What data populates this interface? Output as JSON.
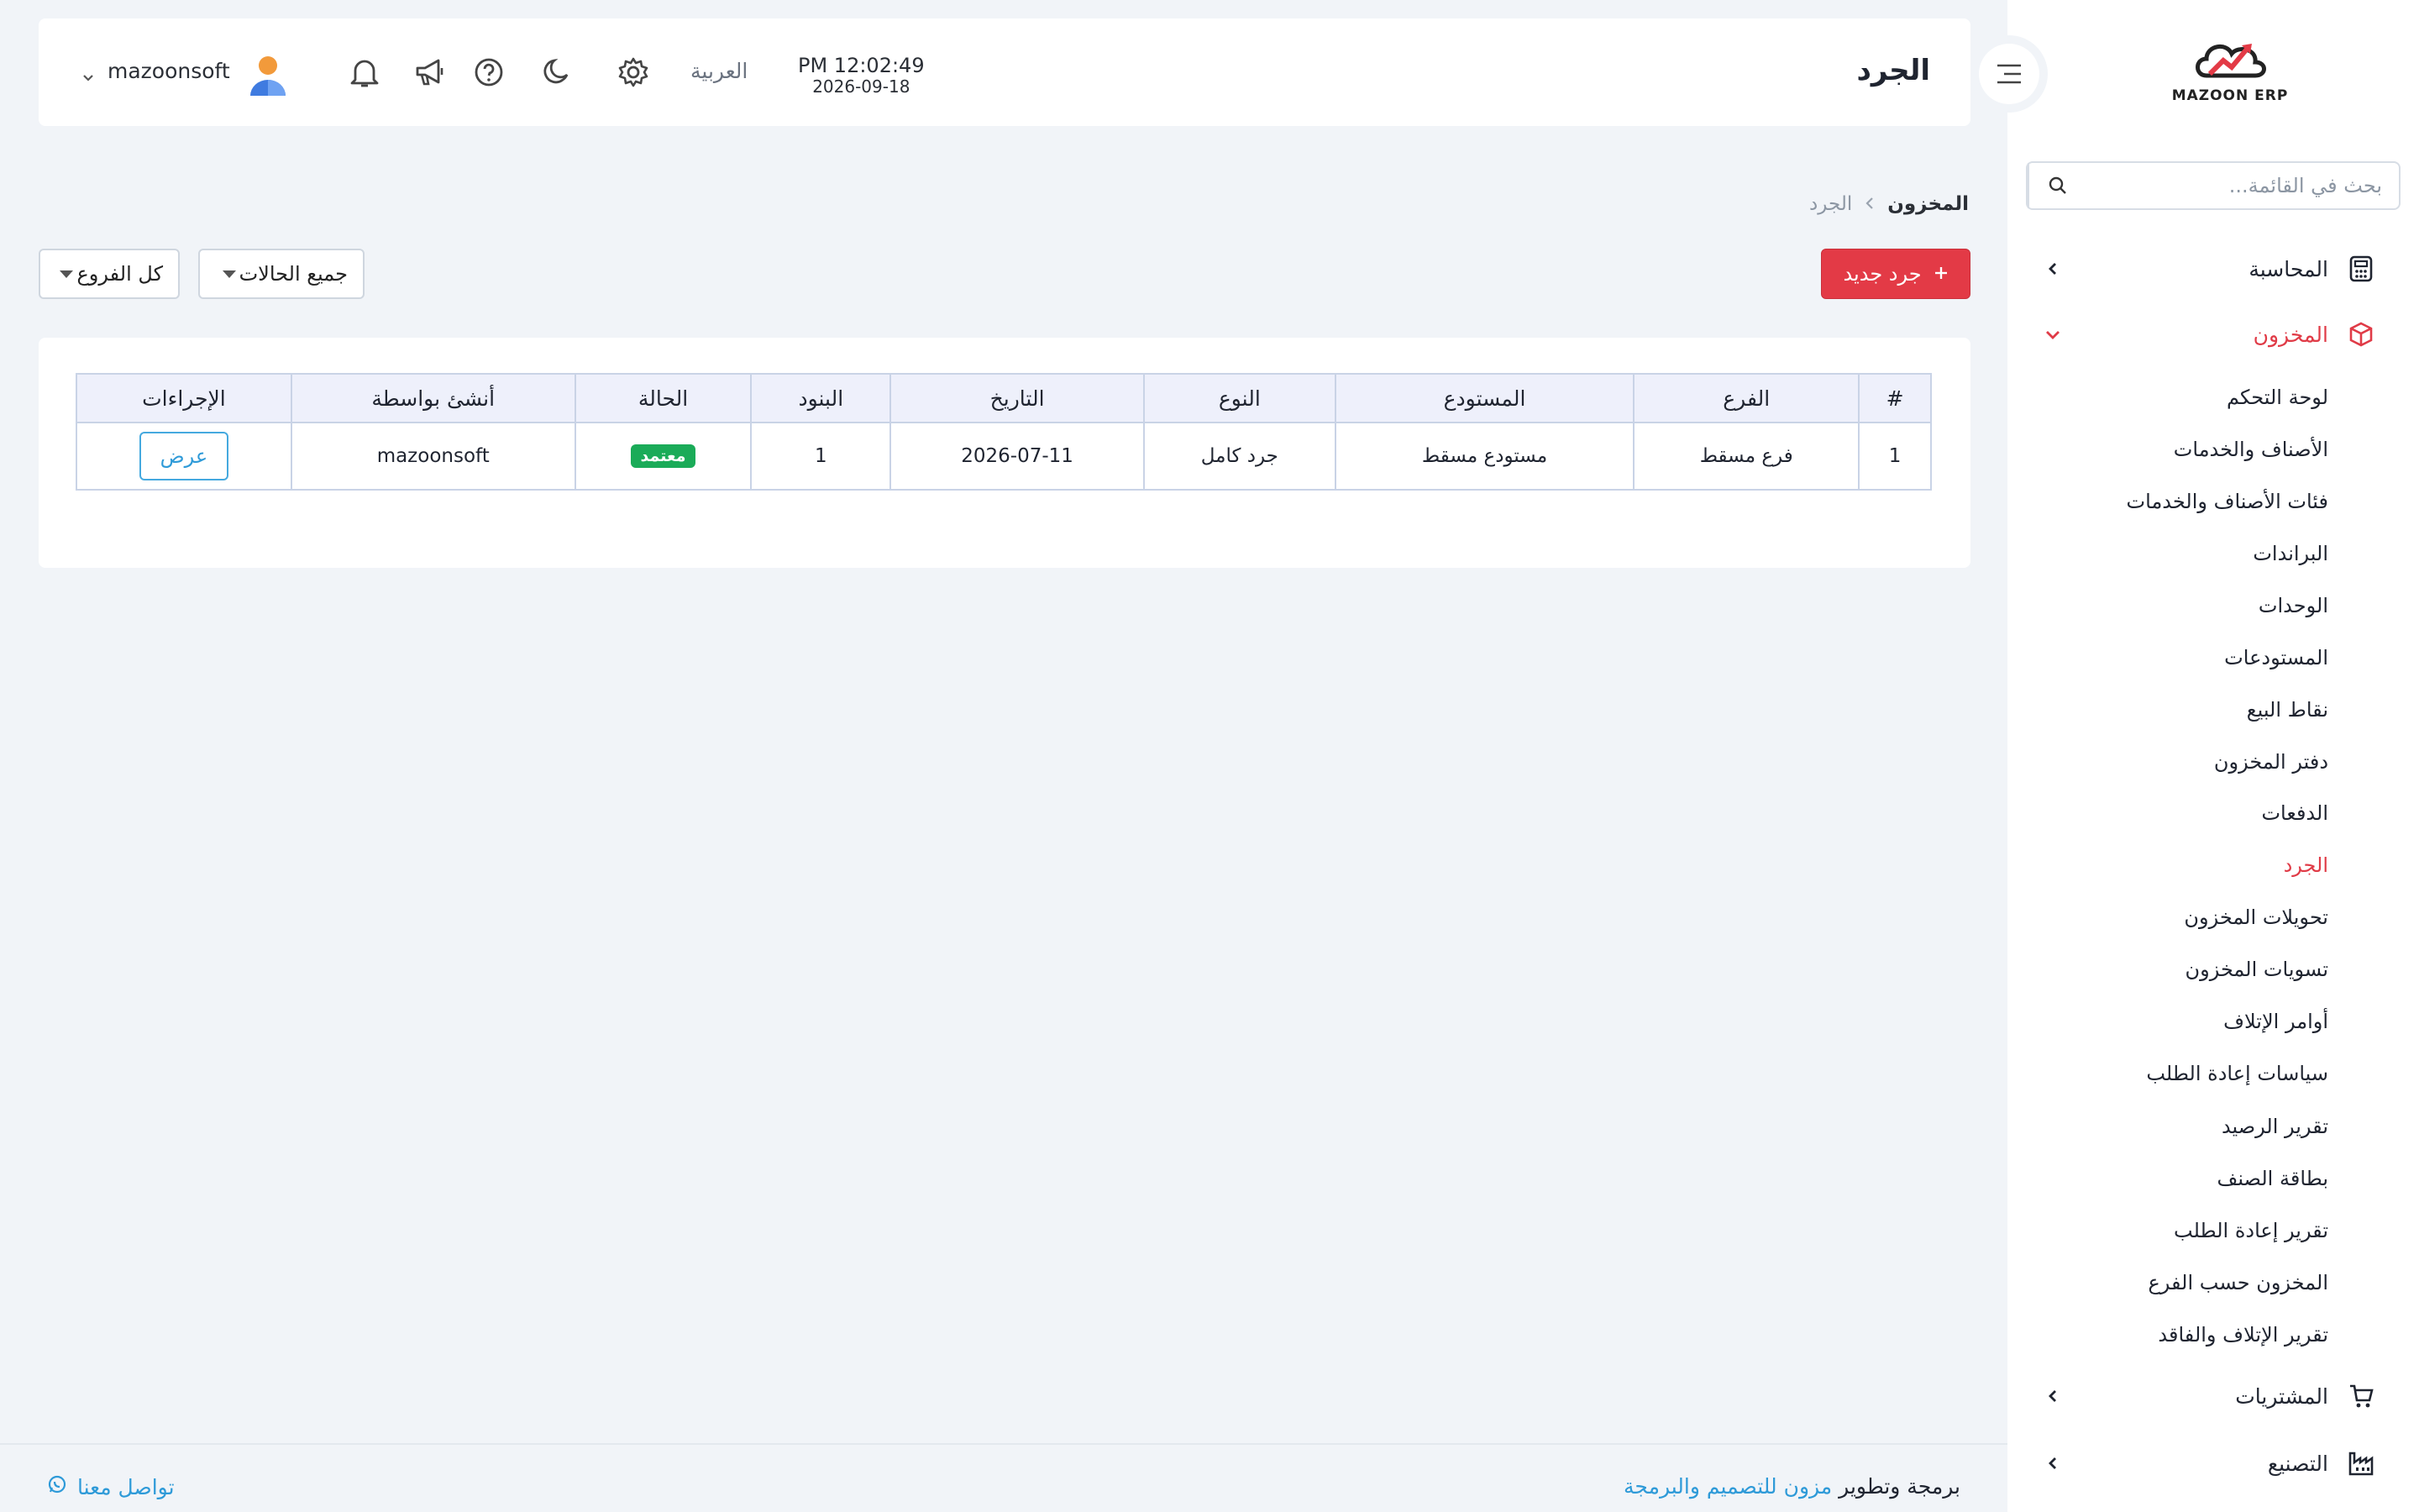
{
  "sidebar": {
    "logo_text": "MAZOON ERP",
    "search_placeholder": "بحث في القائمة...",
    "groups": [
      {
        "label": "المحاسبة",
        "icon": "calculator-icon"
      },
      {
        "label": "المخزون",
        "icon": "box-icon"
      },
      {
        "label": "المشتريات",
        "icon": "cart-icon"
      },
      {
        "label": "التصنيع",
        "icon": "factory-icon"
      }
    ],
    "inventory_items": [
      "لوحة التحكم",
      "الأصناف والخدمات",
      "فئات الأصناف والخدمات",
      "البراندات",
      "الوحدات",
      "المستودعات",
      "نقاط البيع",
      "دفتر المخزون",
      "الدفعات",
      "الجرد",
      "تحويلات المخزون",
      "تسويات المخزون",
      "أوامر الإتلاف",
      "سياسات إعادة الطلب",
      "تقرير الرصيد",
      "بطاقة الصنف",
      "تقرير إعادة الطلب",
      "المخزون حسب الفرع",
      "تقرير الإتلاف والفاقد"
    ]
  },
  "header": {
    "title": "الجرد",
    "time": "PM 12:02:49",
    "date": "2026-09-18",
    "language": "العربية",
    "user": "mazoonsoft"
  },
  "breadcrumb": {
    "parent": "المخزون",
    "current": "الجرد"
  },
  "toolbar": {
    "new_label": "جرد جديد",
    "status_filter": "جميع الحالات",
    "branch_filter": "كل الفروع"
  },
  "table": {
    "headers": [
      "#",
      "الفرع",
      "المستودع",
      "النوع",
      "التاريخ",
      "البنود",
      "الحالة",
      "أنشئ بواسطة",
      "الإجراءات"
    ],
    "rows": [
      {
        "num": "1",
        "branch": "فرع مسقط",
        "warehouse": "مستودع مسقط",
        "type": "جرد كامل",
        "date": "2026-07-11",
        "items": "1",
        "status": "معتمد",
        "created_by": "mazoonsoft",
        "action": "عرض"
      }
    ]
  },
  "footer": {
    "contact": "تواصل معنا",
    "credit_prefix": "برمجة وتطوير",
    "credit_brand": "مزون للتصميم والبرمجة"
  },
  "colors": {
    "accent_red": "#e33a46",
    "link_blue": "#2e9ad8",
    "badge_green": "#1aab58"
  }
}
